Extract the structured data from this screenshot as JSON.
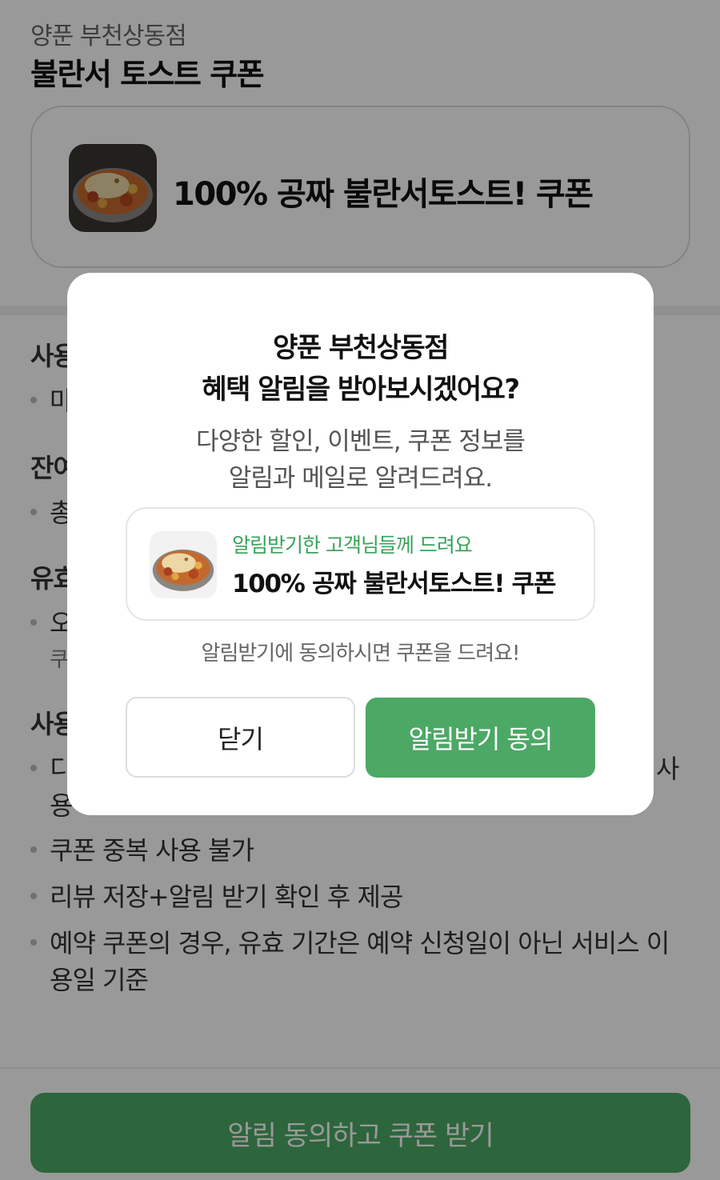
{
  "page": {
    "store_name": "양푼 부천상동점",
    "coupon_title": "불란서 토스트 쿠폰",
    "coupon_card_label": "100% 공짜 불란서토스트! 쿠폰",
    "sections": {
      "usage_title_partial": "사용",
      "usage_item_partial": "마",
      "remaining_title_partial": "잔여",
      "remaining_item_partial": "총",
      "validity_title_partial": "유효",
      "validity_item_partial": "오",
      "validity_sub_partial": "쿠",
      "notice_title_partial": "사용",
      "notice_item1_partial": "디",
      "notice_item1_tail": "사",
      "notice_item1_cont_partial": "용",
      "notice_item2": "쿠폰 중복 사용 불가",
      "notice_item3": "리뷰 저장+알림 받기 확인 후 제공",
      "notice_item4_line1": "예약 쿠폰의 경우, 유효 기간은 예약 신청일이 아닌 서비스 이",
      "notice_item4_line2": "용일 기준"
    },
    "cta_label": "알림 동의하고 쿠폰 받기"
  },
  "modal": {
    "title_line1": "양푼 부천상동점",
    "title_line2": "혜택 알림을 받아보시겠어요?",
    "desc_line1": "다양한 할인, 이벤트, 쿠폰 정보를",
    "desc_line2": "알림과 메일로 알려드려요.",
    "benefit_kicker": "알림받기한 고객님들께 드려요",
    "benefit_title": "100% 공짜 불란서토스트! 쿠폰",
    "note": "알림받기에 동의하시면 쿠폰을 드려요!",
    "close_label": "닫기",
    "agree_label": "알림받기 동의"
  },
  "colors": {
    "accent_green": "#4ca865",
    "kicker_green": "#3aa35a",
    "overlay": "rgba(0,0,0,0.40)"
  },
  "icons": {
    "coupon_thumbnail": "food-photo-icon"
  }
}
